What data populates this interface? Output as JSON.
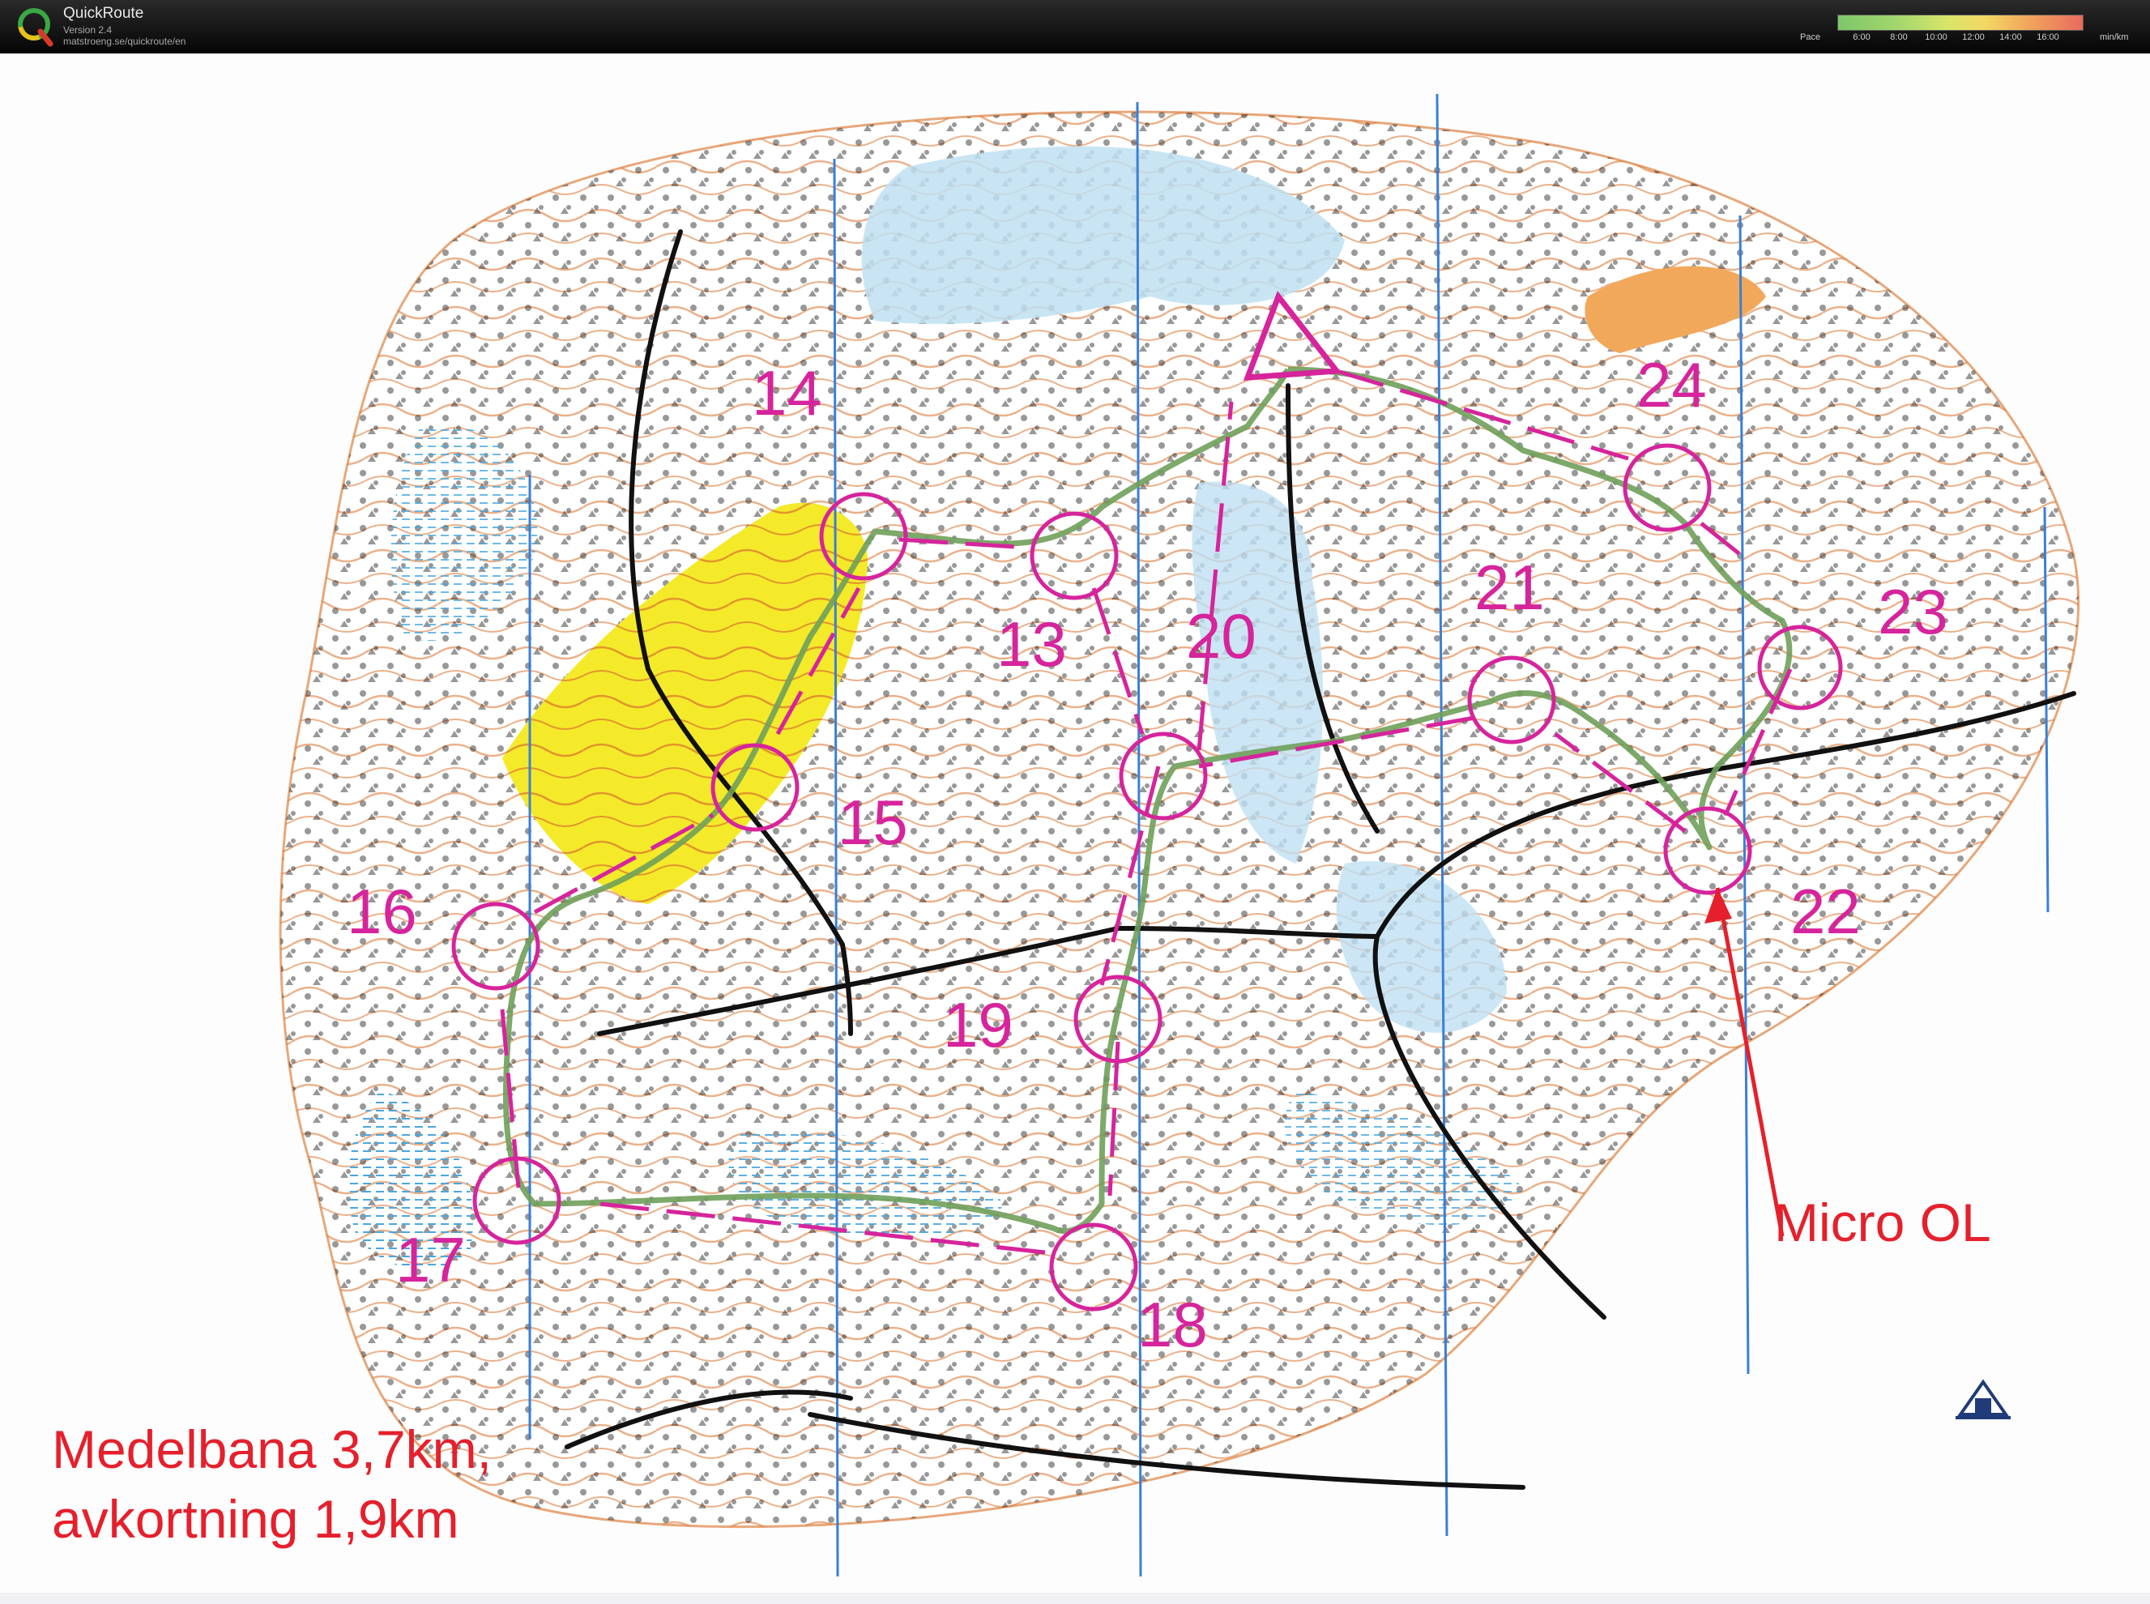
{
  "app": {
    "name": "QuickRoute",
    "version": "Version 2.4",
    "url": "matstroeng.se/quickroute/en"
  },
  "pace_scale": {
    "label": "Pace",
    "ticks": [
      "6:00",
      "8:00",
      "10:00",
      "12:00",
      "14:00",
      "16:00"
    ],
    "unit": "min/km",
    "colors": [
      "#7ec66b",
      "#a4d76d",
      "#d9e56a",
      "#f2d863",
      "#f1a55d",
      "#e86a5e"
    ]
  },
  "map": {
    "controls": [
      "13",
      "14",
      "15",
      "16",
      "17",
      "18",
      "19",
      "20",
      "21",
      "22",
      "23",
      "24"
    ],
    "course_note": [
      "Medelbana 3,7km,",
      "avkortning 1,9km"
    ],
    "micro_label": "Micro OL",
    "colors": {
      "course": "#d6249c",
      "route": "#6fa05a",
      "contour": "#d9712c",
      "water": "#bfe0f2",
      "yellow_area": "#f4ea2a",
      "north_lines": "#3a7fd8",
      "annotation": "#e5202c"
    }
  }
}
